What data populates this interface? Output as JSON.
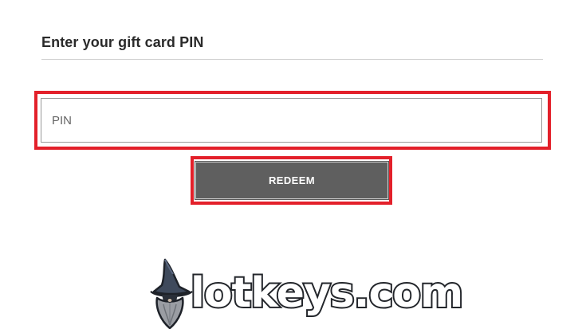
{
  "form": {
    "heading": "Enter your gift card PIN",
    "pin_placeholder": "PIN",
    "pin_value": "",
    "redeem_label": "REDEEM"
  },
  "logo": {
    "text": "lotkeys.com",
    "icon": "wizard-icon"
  },
  "colors": {
    "highlight": "#e3202a",
    "button_bg": "#5f5f5f",
    "button_text": "#ffffff",
    "logo_outline": "#23262b"
  }
}
